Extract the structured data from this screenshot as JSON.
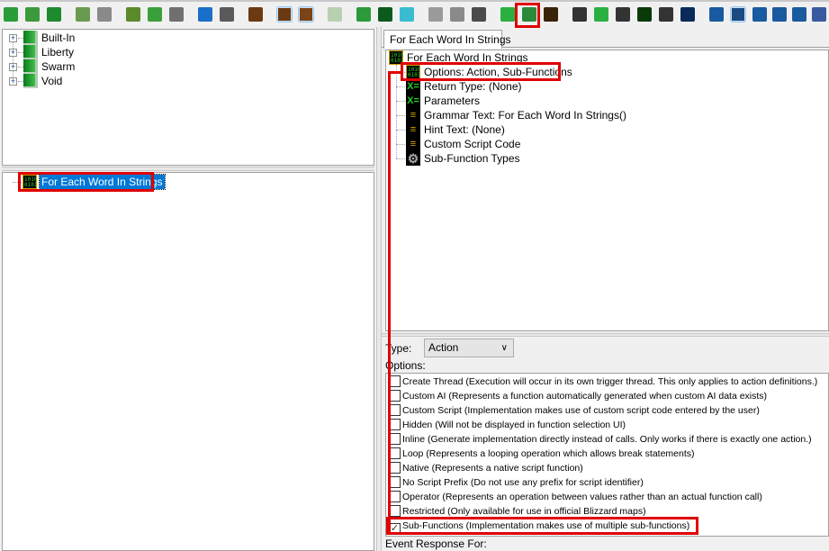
{
  "toolbar": {
    "icons": [
      {
        "name": "new-file-icon",
        "color": "#2a9d3a"
      },
      {
        "name": "open-folder-icon",
        "color": "#3c9a3c"
      },
      {
        "name": "save-icon",
        "color": "#1e8a2e"
      },
      {
        "name": "undo-icon",
        "color": "#6a9a50"
      },
      {
        "name": "redo-icon",
        "color": "#8a8a8a"
      },
      {
        "name": "cut-icon",
        "color": "#5a8a2a"
      },
      {
        "name": "copy-icon",
        "color": "#3ba03b"
      },
      {
        "name": "paste-icon",
        "color": "#707070"
      },
      {
        "name": "back-arrow-icon",
        "color": "#1a6fc8"
      },
      {
        "name": "forward-arrow-icon",
        "color": "#5a5a5a"
      },
      {
        "name": "trigger-module-icon",
        "color": "#6b3a12"
      },
      {
        "name": "trigger-list-icon",
        "color": "#6b3a12",
        "active": true
      },
      {
        "name": "trigger-panel-icon",
        "color": "#7a4418",
        "active": true
      },
      {
        "name": "script-doc-icon",
        "color": "#b8d0b0"
      },
      {
        "name": "folder-icon",
        "color": "#2a9a3a"
      },
      {
        "name": "terminal-icon",
        "color": "#0d5a1d"
      },
      {
        "name": "preset-icon",
        "color": "#3abcd0"
      },
      {
        "name": "flag-icon",
        "color": "#9a9a9a"
      },
      {
        "name": "arrow-right-icon",
        "color": "#8a8a8a"
      },
      {
        "name": "clapper-icon",
        "color": "#4a4a4a"
      },
      {
        "name": "new-action-icon",
        "color": "#2ab040"
      },
      {
        "name": "new-function-icon",
        "color": "#2a8a3a"
      },
      {
        "name": "function-f-icon",
        "color": "#3a2208"
      },
      {
        "name": "lambda-icon",
        "color": "#333333"
      },
      {
        "name": "variable-a-icon",
        "color": "#2ab040"
      },
      {
        "name": "assign-icon",
        "color": "#333333"
      },
      {
        "name": "record-icon",
        "color": "#0a3a0a"
      },
      {
        "name": "grid-icon",
        "color": "#333333"
      },
      {
        "name": "x-equals-icon",
        "color": "#0a2a5a"
      },
      {
        "name": "crystal-icon",
        "color": "#1a5aa0"
      },
      {
        "name": "cog-doc-icon",
        "color": "#1a4a80",
        "active": true
      },
      {
        "name": "unit-icon",
        "color": "#1a5aa0"
      },
      {
        "name": "text-a-icon",
        "color": "#1a5aa0"
      },
      {
        "name": "import-icon",
        "color": "#1a5aa0"
      },
      {
        "name": "globe-icon",
        "color": "#3a5aa0"
      }
    ]
  },
  "library_tree": {
    "items": [
      {
        "label": "Built-In"
      },
      {
        "label": "Liberty"
      },
      {
        "label": "Swarm"
      },
      {
        "label": "Void"
      }
    ]
  },
  "element_tree": {
    "items": [
      {
        "label": "For Each Word In Strings",
        "selected": true
      }
    ]
  },
  "detail": {
    "tab_label": "For Each Word In Strings",
    "root": "For Each Word In Strings",
    "children": [
      {
        "label": "Options: Action, Sub-Functions",
        "icon": "binary-icon"
      },
      {
        "label": "Return Type: (None)",
        "icon": "variable-icon"
      },
      {
        "label": "Parameters",
        "icon": "variable-icon"
      },
      {
        "label": "Grammar Text: For Each Word In Strings()",
        "icon": "text-lines-icon"
      },
      {
        "label": "Hint Text: (None)",
        "icon": "text-lines-icon"
      },
      {
        "label": "Custom Script Code",
        "icon": "text-lines-icon"
      },
      {
        "label": "Sub-Function Types",
        "icon": "gear-icon"
      }
    ],
    "type_label": "Type:",
    "type_value": "Action",
    "options_label": "Options:",
    "options": [
      {
        "label": "Create Thread (Execution will occur in its own trigger thread. This only applies to action definitions.)",
        "checked": false
      },
      {
        "label": "Custom AI (Represents a function automatically generated when custom AI data exists)",
        "checked": false
      },
      {
        "label": "Custom Script (Implementation makes use of custom script code entered by the user)",
        "checked": false
      },
      {
        "label": "Hidden (Will not be displayed in function selection UI)",
        "checked": false
      },
      {
        "label": "Inline (Generate implementation directly instead of calls. Only works if there is exactly one action.)",
        "checked": false
      },
      {
        "label": "Loop (Represents a looping operation which allows break statements)",
        "checked": false
      },
      {
        "label": "Native (Represents a native script function)",
        "checked": false
      },
      {
        "label": "No Script Prefix (Do not use any prefix for script identifier)",
        "checked": false
      },
      {
        "label": "Operator (Represents an operation between values rather than an actual function call)",
        "checked": false
      },
      {
        "label": "Restricted (Only available for use in official Blizzard maps)",
        "checked": false
      },
      {
        "label": "Sub-Functions (Implementation makes use of multiple sub-functions)",
        "checked": true
      }
    ],
    "event_response_label": "Event Response For:"
  },
  "colors": {
    "highlight": "#e00000",
    "selection": "#0078d7"
  }
}
